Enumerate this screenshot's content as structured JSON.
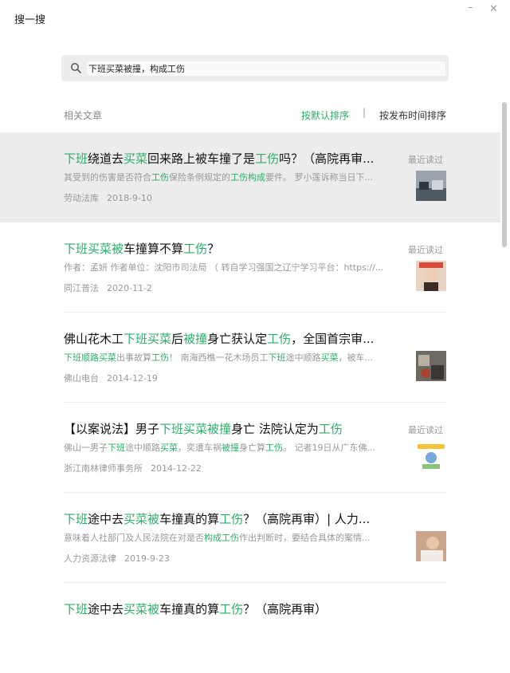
{
  "window": {
    "title": "搜一搜",
    "minimize": "–",
    "close": "✕"
  },
  "search": {
    "query": "下班买菜被撞，构成工伤",
    "icon": "search-icon"
  },
  "list_header": {
    "section_label": "相关文章",
    "sort_default": "按默认排序",
    "separator": "|",
    "sort_time": "按发布时间排序"
  },
  "colors": {
    "accent": "#2aae67",
    "highlight_bg": "#ececec",
    "muted": "#999999"
  },
  "results": [
    {
      "title": [
        "下班",
        "绕道去",
        "买菜",
        "回来路上被车撞了是",
        "工伤",
        "吗？（高院再审..."
      ],
      "snippet": [
        "其受到的伤害是否符合",
        "工伤",
        "保险条例规定的",
        "工伤构成",
        "要件。 罗小莲诉称当日",
        "下..."
      ],
      "source": "劳动法库",
      "date": "2018-9-10",
      "recent": "最近读过"
    },
    {
      "title": [
        "下班",
        "",
        "买菜",
        "",
        "被",
        "车撞算不算",
        "工伤",
        "？"
      ],
      "snippet": [
        "作者：孟妍 作者单位：沈阳市司法局 （ 转自学习强国之辽宁学习平台：https://..."
      ],
      "source": "同江普法",
      "date": "2020-11-2",
      "recent": "最近读过"
    },
    {
      "title": [
        "佛山花木工",
        "下班",
        "",
        "买菜",
        "后",
        "被撞",
        "身亡获认定",
        "工伤",
        "，全国首宗审..."
      ],
      "snippet": [
        "下班",
        "顺路",
        "买菜",
        "出事故算",
        "工伤",
        "！ 南海西樵一花木场员工",
        "下班",
        "途中顺路",
        "买菜",
        "，被车..."
      ],
      "source": "佛山电台",
      "date": "2014-12-19",
      "recent": ""
    },
    {
      "title": [
        "【以案说法】男子",
        "下班",
        "",
        "买菜",
        "",
        "被撞",
        "身亡 法院认定为",
        "工伤"
      ],
      "snippet": [
        "佛山一男子",
        "下班",
        "途中顺路",
        "买菜",
        "，奕遭车祸",
        "被撞",
        "身亡算",
        "工伤",
        "。 记者19日从广东佛..."
      ],
      "source": "浙江南林律师事务所",
      "date": "2014-12-22",
      "recent": "最近读过"
    },
    {
      "title": [
        "下班",
        "途中去",
        "买菜",
        "",
        "被",
        "车撞真的算",
        "工伤",
        "？（高院再审）| 人力..."
      ],
      "snippet": [
        "意味着人社部门及人民法院在对是否",
        "构成工伤",
        "作出判断时，要结合具体的案情..."
      ],
      "source": "人力资源法律",
      "date": "2019-9-23",
      "recent": ""
    },
    {
      "title": [
        "下班",
        "途中去",
        "买菜",
        "",
        "被",
        "车撞真的算",
        "工伤",
        "？（高院再审）"
      ],
      "snippet": [
        ""
      ],
      "source": "",
      "date": "",
      "recent": ""
    }
  ]
}
